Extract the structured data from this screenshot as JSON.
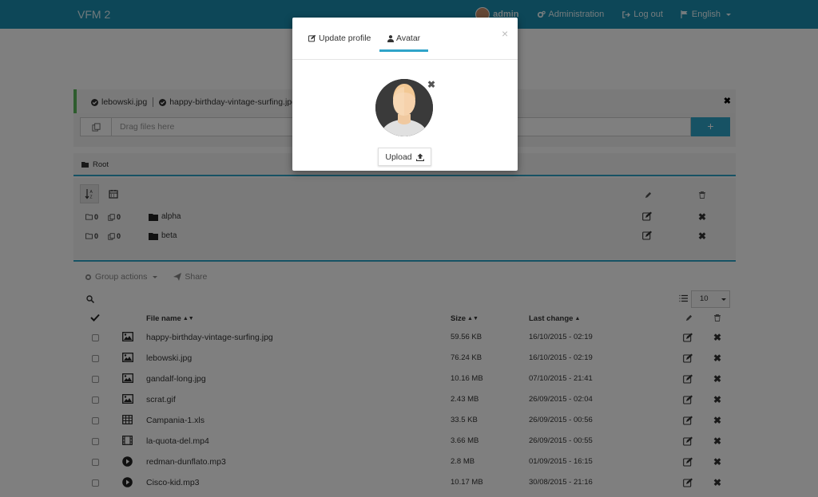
{
  "navbar": {
    "brand": "VFM 2",
    "user": "admin",
    "administration": "Administration",
    "logout": "Log out",
    "language": "English"
  },
  "uploaded": {
    "files": [
      "lebowski.jpg",
      "happy-birthday-vintage-surfing.jpg"
    ]
  },
  "dropzone": {
    "placeholder": "Drag files here",
    "button": "+"
  },
  "breadcrumb": {
    "root": "Root"
  },
  "folders": [
    {
      "name": "alpha",
      "folders": "0",
      "files": "0"
    },
    {
      "name": "beta",
      "folders": "0",
      "files": "0"
    }
  ],
  "toolbar": {
    "group_actions": "Group actions",
    "share": "Share",
    "per_page": "10"
  },
  "table": {
    "headers": {
      "name": "File name",
      "size": "Size",
      "date": "Last change"
    },
    "rows": [
      {
        "icon": "image",
        "name": "happy-birthday-vintage-surfing.jpg",
        "size": "59.56 KB",
        "date": "16/10/2015 - 02:19"
      },
      {
        "icon": "image",
        "name": "lebowski.jpg",
        "size": "76.24 KB",
        "date": "16/10/2015 - 02:19"
      },
      {
        "icon": "image",
        "name": "gandalf-long.jpg",
        "size": "10.16 MB",
        "date": "07/10/2015 - 21:41"
      },
      {
        "icon": "image",
        "name": "scrat.gif",
        "size": "2.43 MB",
        "date": "26/09/2015 - 02:04"
      },
      {
        "icon": "table",
        "name": "Campania-1.xls",
        "size": "33.5 KB",
        "date": "26/09/2015 - 00:56"
      },
      {
        "icon": "film",
        "name": "la-quota-del.mp4",
        "size": "3.66 MB",
        "date": "26/09/2015 - 00:55"
      },
      {
        "icon": "play",
        "name": "redman-dunflato.mp3",
        "size": "2.8 MB",
        "date": "01/09/2015 - 16:15"
      },
      {
        "icon": "play",
        "name": "Cisco-kid.mp3",
        "size": "10.17 MB",
        "date": "30/08/2015 - 21:16"
      }
    ]
  },
  "modal": {
    "tab_profile": "Update profile",
    "tab_avatar": "Avatar",
    "close": "×",
    "upload": "Upload",
    "remove": "✖"
  },
  "colors": {
    "navbar": "#1a8fb0",
    "accent": "#2fa4c9",
    "success": "#5cb85c"
  }
}
